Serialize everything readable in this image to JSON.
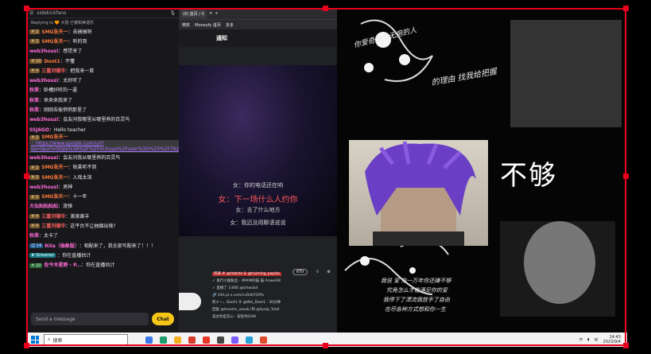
{
  "chat": {
    "channel": "sidekickfans",
    "reply_line": "Replying to 🧡 大陆 已被和美语乐",
    "messages": [
      {
        "badge": "♆ 2",
        "user": "SMG张天一",
        "user_color": "#ff7a3d",
        "text": "：去搞搞呀"
      },
      {
        "badge": "♆ 2",
        "user": "SMG张天一",
        "user_color": "#ff7a3d",
        "text": "：听的到"
      },
      {
        "badge": "",
        "user": "web3houzi",
        "user_color": "#ff6ad5",
        "text": "：感觉来了"
      },
      {
        "badge": "♆ 10",
        "user": "Dont1",
        "user_color": "#ff7a3d",
        "text": "：不懂"
      },
      {
        "badge": "♆ 4",
        "user": "三重刘德华",
        "user_color": "#ff6161",
        "text": "：把我来一首"
      },
      {
        "badge": "",
        "user": "web3houzi",
        "user_color": "#ff6ad5",
        "text": "：太好听了"
      },
      {
        "badge": "",
        "user": "秋莱",
        "user_color": "#ff6ad5",
        "text": "：卧槽好听的一逼"
      },
      {
        "badge": "",
        "user": "秋莱",
        "user_color": "#ff6ad5",
        "text": "：来来来我来了"
      },
      {
        "badge": "",
        "user": "秋莱",
        "user_color": "#ff6ad5",
        "text": "：刚刚去偷悄悄那里了"
      },
      {
        "badge": "",
        "user": "web3houzi",
        "user_color": "#ff6ad5",
        "text": "：会友问我哪里从哪里养的百灵鸟"
      },
      {
        "badge": "",
        "user": "SSJ6GO",
        "user_color": "#ff6ad5",
        "text": "：Hello teacher"
      },
      {
        "badge": "♆ 2",
        "user": "SMG张天一",
        "user_color": "#ff7a3d",
        "text": "：https://www.google.com/url?sa=i&url=https%3A%2F%2Fm.huya%2Fuser%3D%25%2F7622%26...",
        "link": true
      },
      {
        "badge": "",
        "user": "web3houzi",
        "user_color": "#ff6ad5",
        "text": "：会友问我从哪里养的百灵鸟"
      },
      {
        "badge": "♆ 2",
        "user": "SMG张天一",
        "user_color": "#ff7a3d",
        "text": "：秋莱听不到"
      },
      {
        "badge": "♆ 2",
        "user": "SMG张天一",
        "user_color": "#ff7a3d",
        "text": "：入戏太深"
      },
      {
        "badge": "",
        "user": "web3houzi",
        "user_color": "#ff6ad5",
        "text": "：男神"
      },
      {
        "badge": "♆ 2",
        "user": "SMG张天一",
        "user_color": "#ff7a3d",
        "text": "：十一年"
      },
      {
        "badge": "",
        "user": "大仙灿灿灿灿",
        "user_color": "#ff6ad5",
        "text": "：泼弹"
      },
      {
        "badge": "♆ 4",
        "user": "三重刘德华",
        "user_color": "#ff6161",
        "text": "：滚滚黄羊"
      },
      {
        "badge": "♆ 4",
        "user": "三重刘德华",
        "user_color": "#ff6161",
        "text": "：这平台不让抽烟出境?"
      },
      {
        "badge": "",
        "user": "秋莱",
        "user_color": "#ff6ad5",
        "text": "：太卡了"
      },
      {
        "badge": "☺ 14",
        "badge_kind": "blue",
        "user": "Rita（抽象版）",
        "user_color": "#ff6ad5",
        "text": "：相配来了，我全部写配来了！！！"
      },
      {
        "badge": "♦ Streamer",
        "badge_kind": "teal",
        "user": "",
        "user_color": "#ff6ad5",
        "text": "：你在直播估计"
      },
      {
        "badge": "♆ 20",
        "badge_kind": "green",
        "user": "佐今木星野 - P...",
        "user_color": "#ff6ad5",
        "text": "：你在直播估计"
      }
    ],
    "input_placeholder": "Send a message",
    "chat_button": "Chat"
  },
  "browser": {
    "tab_label": "(8) 首页 / X",
    "bookmarks": [
      "微软",
      "Moneyfy 首页",
      "多多"
    ],
    "notify_title": "通知",
    "lyrics": [
      "女：你的电话还在响",
      "女：下一场什么人约你",
      "女：去了什么地方",
      "女：我迈没用聊语说说"
    ],
    "ktv_label": "KTV",
    "feed": [
      "风采 ⑧ @Hobsto & @huiming_papido",
      "✓ 发行小猴粉丝 - 冲冲冲的猫 猫 Anwei08",
      "✓ 直播了 3,666 @sihwcbd",
      "🔗 24h.pl.x.com/cvDeKYGPts",
      "陈十一，Dont1 ⑧ @Wei_Dom1 · 30分钟",
      "回复 @Huoshc_sasaki 和 @liyolp_Yuldl",
      "美女你是先心 · 安抚你GAN"
    ]
  },
  "art": {
    "big_text": "不够",
    "calligraphy_top": "你爱奇是个无用的人",
    "calligraphy_mid": "的理由 找我给把握",
    "calligraphy_bottom": [
      "我说 爱 你一万年你还嫌不够",
      "究竟怎么才能满足你的爱",
      "我停下了漂流我放手了自由",
      "在尽各种方式想和你一生"
    ]
  },
  "taskbar": {
    "search_placeholder": "搜索",
    "time": "24:43",
    "date": "2023/9/4",
    "lang": "中"
  },
  "colors": {
    "selection": "#e8001c",
    "chat_bg": "#18181b",
    "accent_button": "#f5c518"
  }
}
